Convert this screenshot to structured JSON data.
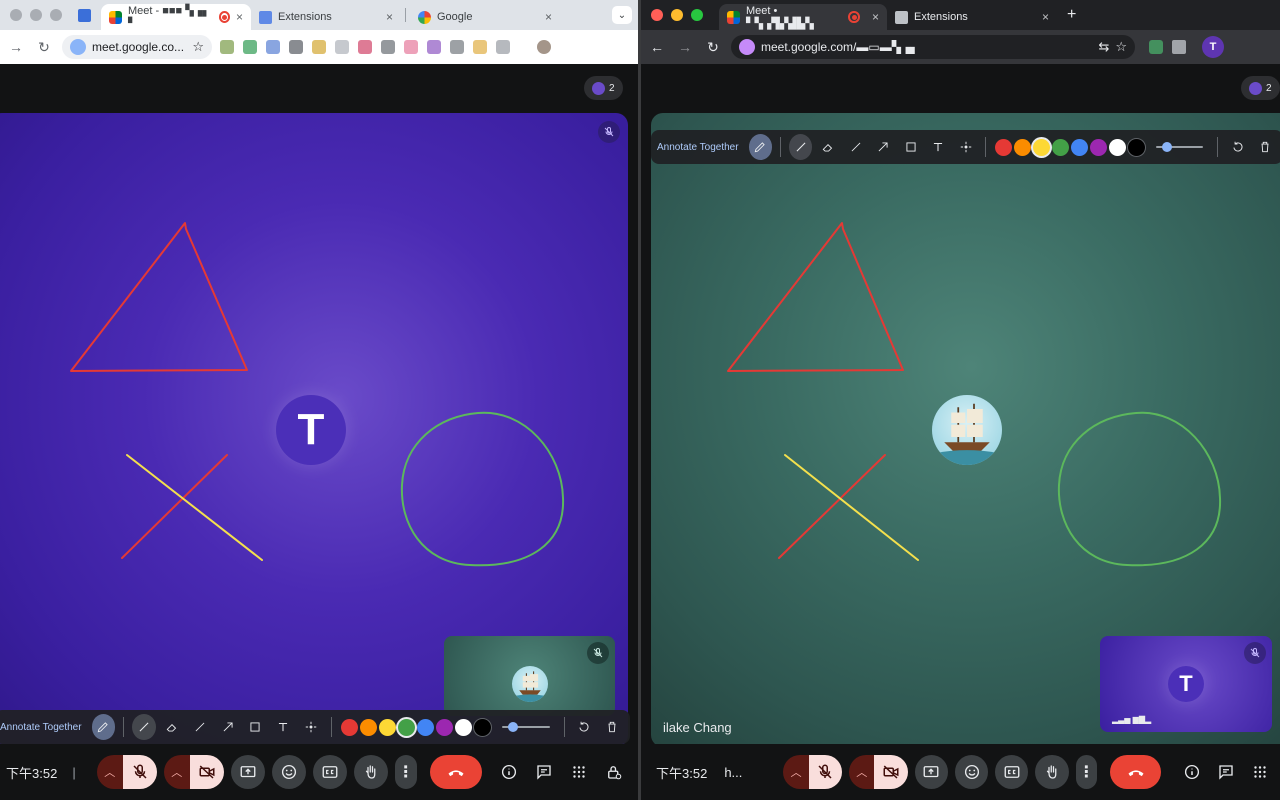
{
  "colors": {
    "pen_red": "#e53935",
    "pen_yellow": "#f4e04d",
    "pen_green": "#5cb85c",
    "hangup": "#ea4335",
    "left_tile_bg": "#4a2ab3",
    "right_tile_bg": "#3a6b62"
  },
  "left": {
    "tabs": [
      {
        "title": "Meet - ■■■ ▚▗▖ ▘",
        "favicon": "meet-icon",
        "recording": true,
        "active": true
      },
      {
        "title": "Extensions",
        "favicon": "extensions-icon",
        "active": false
      },
      {
        "title": "Google",
        "favicon": "google-icon",
        "active": false
      }
    ],
    "tab_close": "×",
    "tab_menu": "⌄",
    "omnibox_url": "meet.google.co...",
    "participants_count": "2",
    "annotate_title": "Annotate Together",
    "clock": "下午3:52",
    "pipe": "|"
  },
  "right": {
    "tabs": [
      {
        "title": "Meet • ▘▚▗▜▞▟▙▚",
        "favicon": "meet-icon",
        "recording": true,
        "active": true
      },
      {
        "title": "Extensions",
        "favicon": "extensions-icon",
        "active": false
      }
    ],
    "tab_close": "×",
    "new_tab": "+",
    "omnibox_url": "meet.google.com/▬▭▬▚▗▖",
    "profile_initial": "T",
    "participants_count": "2",
    "annotate_title": "Annotate Together",
    "participant_name": "ilake Chang",
    "self_tile_name": "▂▃▅ ▆▇▂",
    "clock": "下午3:52",
    "meet_code": "h..."
  },
  "avatar_initial": "T",
  "annotation_tools": [
    {
      "name": "pen-tool",
      "selected": false
    },
    {
      "name": "line-tool",
      "selected": true
    },
    {
      "name": "eraser-tool",
      "selected": false
    },
    {
      "name": "straight-line-tool",
      "selected": false
    },
    {
      "name": "arrow-tool",
      "selected": false
    },
    {
      "name": "rectangle-tool",
      "selected": false
    },
    {
      "name": "text-tool",
      "selected": false
    },
    {
      "name": "laser-pointer-tool",
      "selected": false
    }
  ],
  "annotation_swatches": [
    "#e53935",
    "#fb8c00",
    "#fdd835",
    "#43a047",
    "#4285f4",
    "#9c27b0",
    "#ffffff",
    "#000000"
  ],
  "left_selected_swatch": 3,
  "right_selected_swatch": 2,
  "stroke_width_level": 0.15
}
